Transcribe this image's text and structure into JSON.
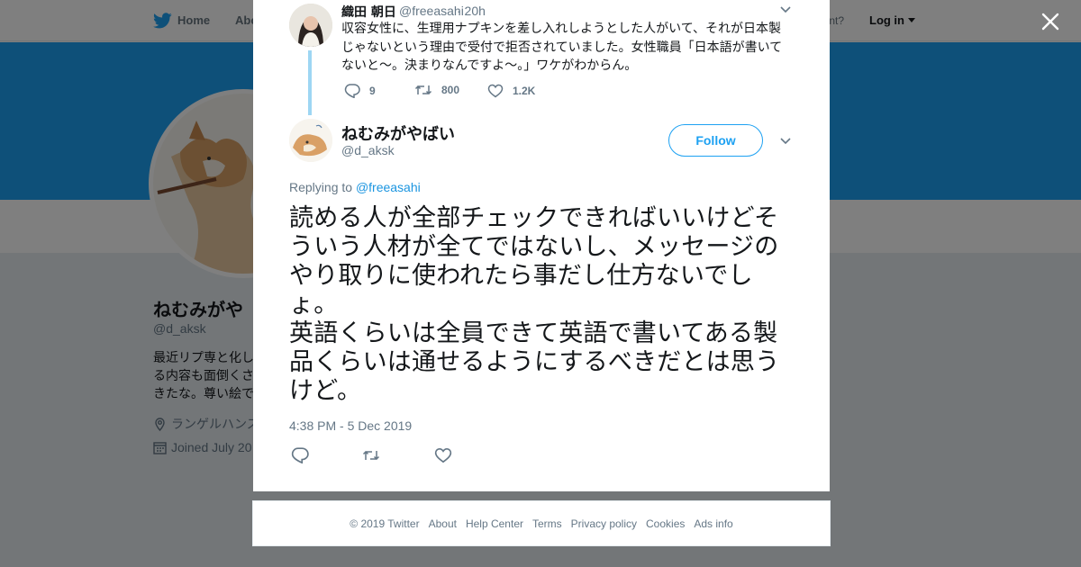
{
  "nav": {
    "home_label": "Home",
    "about_label": "Abo",
    "account_prompt": "ccount?",
    "login_label": "Log in"
  },
  "profile": {
    "name": "ねむみがや",
    "handle": "@d_aksk",
    "bio": "最近リプ専と化し\nる内容も面倒くさ\nきたな。尊い絵で",
    "location": "ランゲルハンス",
    "joined": "Joined July 20"
  },
  "parent_tweet": {
    "author_name": "織田 朝日",
    "handle": "@freeasahi",
    "time": "· 20h",
    "text": "収容女性に、生理用ナプキンを差し入れしようとした人がいて、それが日本製じゃないという理由で受付で拒否されていました。女性職員「日本語が書いてないと～。決まりなんですよ～。」ワケがわからん。",
    "replies": "9",
    "retweets": "800",
    "likes": "1.2K"
  },
  "tweet": {
    "author_name": "ねむみがやばい",
    "handle": "@d_aksk",
    "follow_label": "Follow",
    "replying_to_label": "Replying to",
    "replying_to_handle": "@freeasahi",
    "text": "読める人が全部チェックできればいいけどそういう人材が全てではないし、メッセージのやり取りに使われたら事だし仕方ないでしょ。\n英語くらいは全員できて英語で書いてある製品くらいは通せるようにするべきだとは思うけど。",
    "timestamp": "4:38 PM - 5 Dec 2019"
  },
  "footer": {
    "copyright": "© 2019 Twitter",
    "about": "About",
    "help": "Help Center",
    "terms": "Terms",
    "privacy": "Privacy policy",
    "cookies": "Cookies",
    "ads": "Ads info"
  },
  "colors": {
    "brand": "#1da1f2",
    "link": "#1b95e0",
    "text": "#14171a",
    "secondary": "#657786",
    "thread": "#9ed6f3"
  },
  "icons": [
    "twitter-bird-icon",
    "close-icon",
    "caret-down-icon",
    "reply-icon",
    "retweet-icon",
    "like-icon",
    "location-icon",
    "calendar-icon"
  ]
}
